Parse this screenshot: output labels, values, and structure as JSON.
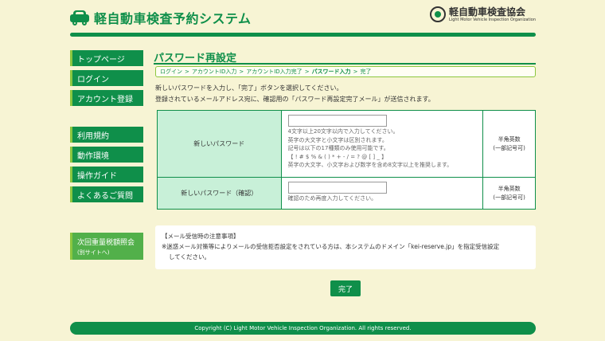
{
  "header": {
    "site_title": "軽自動車検査予約システム",
    "org_name": "軽自動車検査協会",
    "org_name_en": "Light Motor Vehicle Inspection Organization"
  },
  "sidebar": {
    "top_items": [
      "トップページ",
      "ログイン",
      "アカウント登録"
    ],
    "info_items": [
      "利用規約",
      "動作環境",
      "操作ガイド",
      "よくあるご質問"
    ],
    "special": {
      "label": "次回重量税額照会",
      "sub": "(別サイトへ)"
    }
  },
  "main": {
    "title": "パスワード再設定",
    "breadcrumb": [
      "ログイン",
      ">",
      "アカウントID入力",
      ">",
      "アカウントID入力完了",
      ">",
      "パスワード入力",
      ">",
      "完了"
    ],
    "intro_line1": "新しいパスワードを入力し、「完了」ボタンを選択してください。",
    "intro_line2": "登録されているメールアドレス宛に、確認用の「パスワード再設定完了メール」が送信されます。",
    "form": {
      "new_password": {
        "label": "新しいパスワード",
        "value": "",
        "hints": [
          "4文字以上20文字以内で入力してください。",
          "英字の大文字と小文字は区別されます。",
          "記号は以下の17種類のみ使用可能です。",
          "【 ! # $ % & ( ) * + - / = ? @ [ ] _ 】",
          "英字の大文字、小文字および数字を含め8文字以上を推奨します。"
        ],
        "note_line1": "半角英数",
        "note_line2": "(一部記号可)"
      },
      "confirm_password": {
        "label": "新しいパスワード（確認）",
        "value": "",
        "hint": "確認のため再度入力してください。",
        "note_line1": "半角英数",
        "note_line2": "(一部記号可)"
      }
    },
    "notice_title": "【メール受信時の注意事項】",
    "notice_line1": "※迷惑メール対策等によりメールの受信拒否設定をされている方は、本システムのドメイン「kei-reserve.jp」を指定受信設定",
    "notice_line2": "してください。",
    "submit_label": "完了"
  },
  "footer": {
    "copyright": "Copyright (C) Light Motor Vehicle Inspection Organization. All rights reserved."
  }
}
